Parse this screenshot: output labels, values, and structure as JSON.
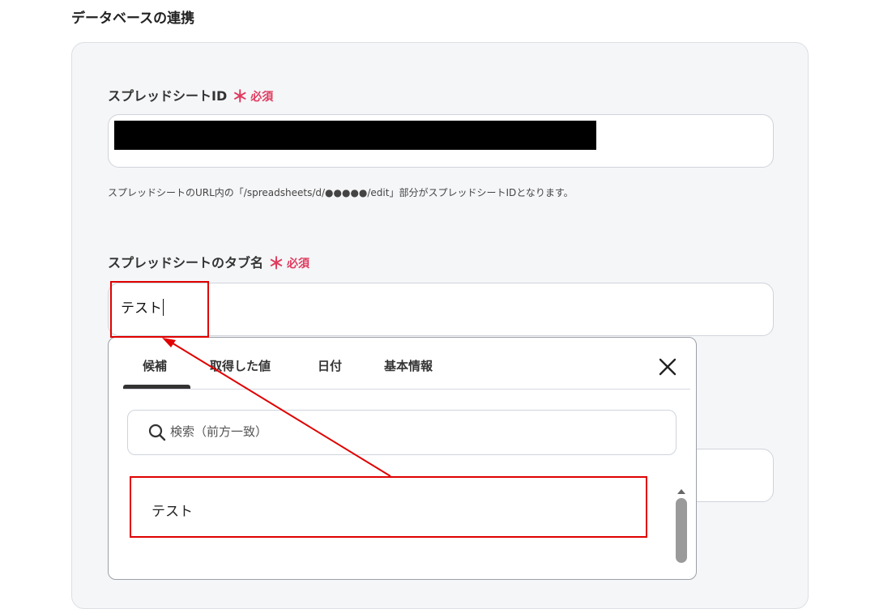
{
  "section": {
    "title": "データベースの連携"
  },
  "spreadsheet_id": {
    "label": "スプレッドシートID",
    "required_mark": "＊",
    "required_text": "必須",
    "help": "スプレッドシートのURL内の「/spreadsheets/d/●●●●●/edit」部分がスプレッドシートIDとなります。"
  },
  "sheet_tab": {
    "label": "スプレッドシートのタブ名",
    "required_mark": "＊",
    "required_text": "必須",
    "value": "テスト"
  },
  "dropdown": {
    "tabs": [
      "候補",
      "取得した値",
      "日付",
      "基本情報"
    ],
    "active_tab": "候補",
    "search_placeholder": "検索（前方一致）",
    "items": [
      "テスト"
    ]
  },
  "colors": {
    "required": "#e03a5e",
    "annotation": "#e00000",
    "card_bg": "#f5f6f8"
  },
  "icons": {
    "close": "close-icon",
    "search": "search-icon",
    "scroll_up": "chevron-up-icon"
  }
}
